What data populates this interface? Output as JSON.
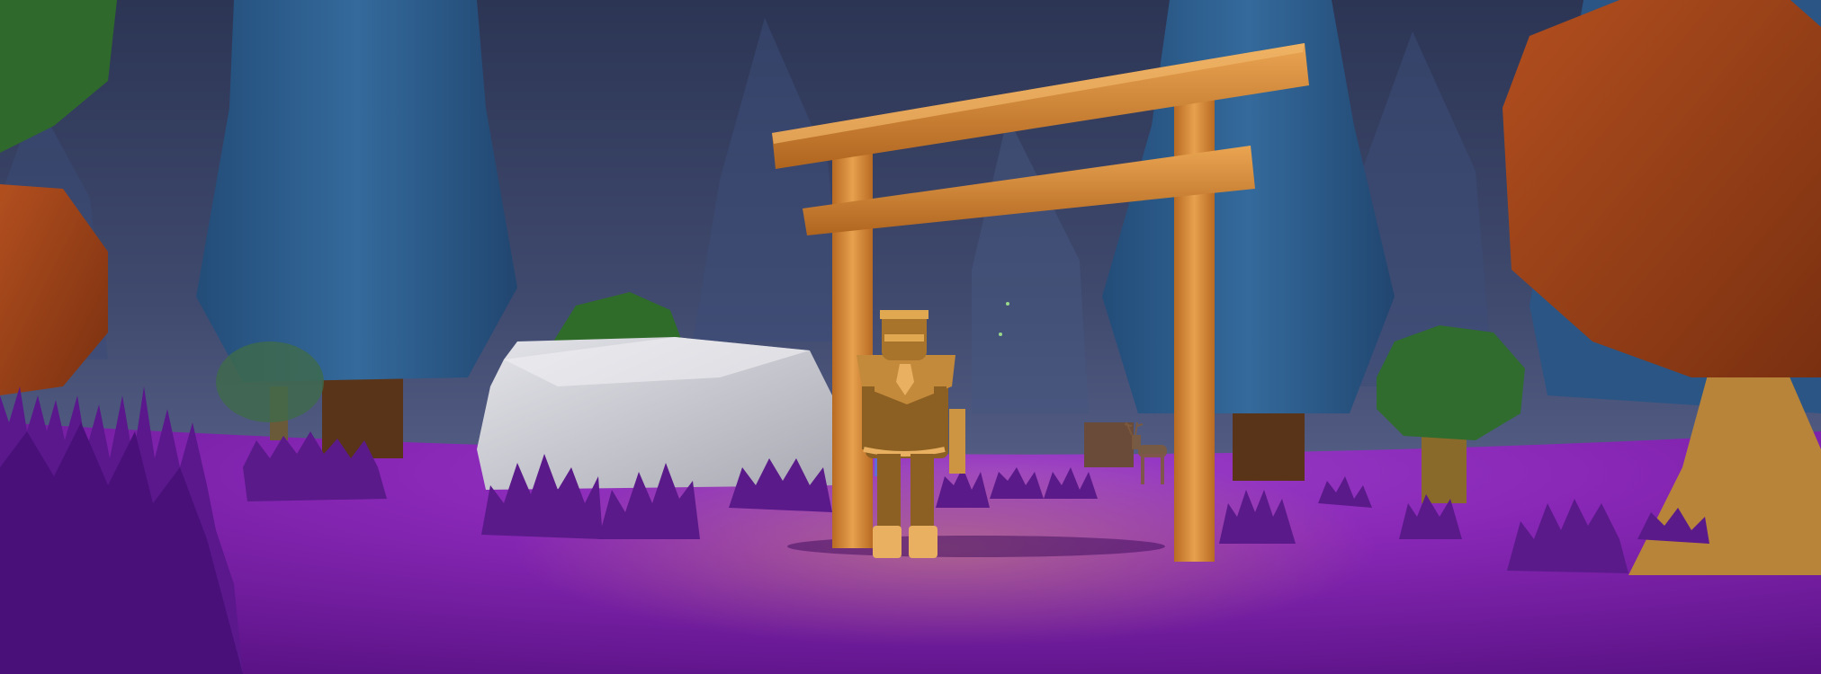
{
  "scene": {
    "palette": {
      "sky_top": "#2f3858",
      "sky_mid": "#4a5478",
      "fog": "#56608a",
      "ground_purple": "#7a1fa8",
      "ground_dark": "#4a0f6c",
      "grass": "#5a1a8a",
      "grass_dark": "#3e0e66",
      "pine_blue": "#2d5f8e",
      "pine_blue_dark": "#214a74",
      "bark_brown": "#5a3418",
      "oak_orange": "#a2451b",
      "oak_orange_dark": "#7c3312",
      "bush_green": "#2c6a2e",
      "torii_wood": "#c77a2e",
      "torii_wood_light": "#e39a4a",
      "rock_white": "#cfcfd6",
      "player_armor": "#9a6a2a"
    },
    "objects": [
      "torii-gate",
      "player-character",
      "white-boulder",
      "blue-pine-trees",
      "orange-round-tree",
      "green-round-bushes",
      "purple-grass-tufts",
      "distant-deer"
    ]
  }
}
